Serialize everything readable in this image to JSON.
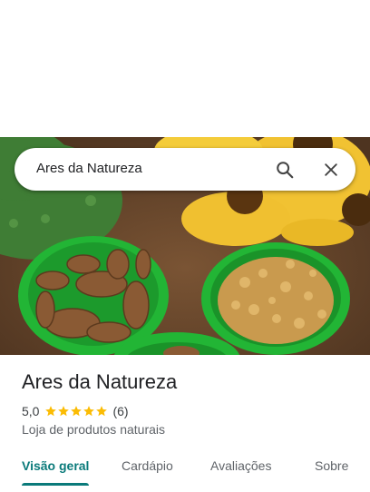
{
  "search": {
    "query": "Ares da Natureza"
  },
  "place": {
    "name": "Ares da Natureza",
    "rating": "5,0",
    "rating_value": 5,
    "review_count": "(6)",
    "category": "Loja de produtos naturais"
  },
  "tabs": [
    {
      "label": "Visão geral",
      "active": true
    },
    {
      "label": "Cardápio",
      "active": false
    },
    {
      "label": "Avaliações",
      "active": false
    },
    {
      "label": "Sobre",
      "active": false
    }
  ],
  "colors": {
    "accent": "#0a7a7a",
    "star": "#fbbc04",
    "text_primary": "#202124",
    "text_secondary": "#5f6368"
  },
  "icons": {
    "search": "search-icon",
    "close": "close-icon"
  }
}
